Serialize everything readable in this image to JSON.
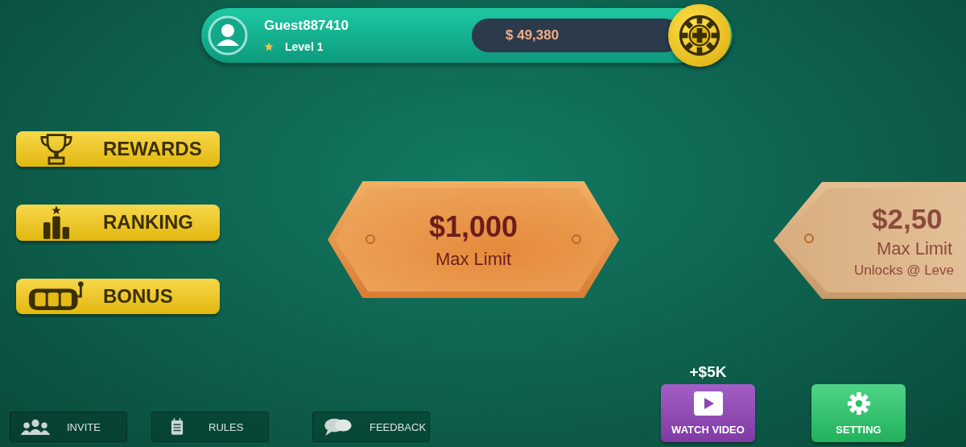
{
  "player": {
    "name": "Guest887410",
    "level": "Level 1",
    "balance": "$ 49,380"
  },
  "menu": [
    {
      "label": "REWARDS",
      "kind": "trophy"
    },
    {
      "label": "RANKING",
      "kind": "ranking"
    },
    {
      "label": "BONUS",
      "kind": "slot"
    }
  ],
  "tables": [
    {
      "amount": "$1,000",
      "caption": "Max Limit",
      "locked": false
    },
    {
      "amount": "$2,50",
      "caption": "Max Limit",
      "note": "Unlocks @ Leve",
      "locked": true
    }
  ],
  "bottom_links": [
    {
      "label": "INVITE",
      "kind": "invite"
    },
    {
      "label": "RULES",
      "kind": "rules"
    },
    {
      "label": "FEEDBACK",
      "kind": "feedback"
    }
  ],
  "watch_video": {
    "reward": "+$5K",
    "label": "WATCH VIDEO"
  },
  "setting": {
    "label": "SETTING"
  }
}
